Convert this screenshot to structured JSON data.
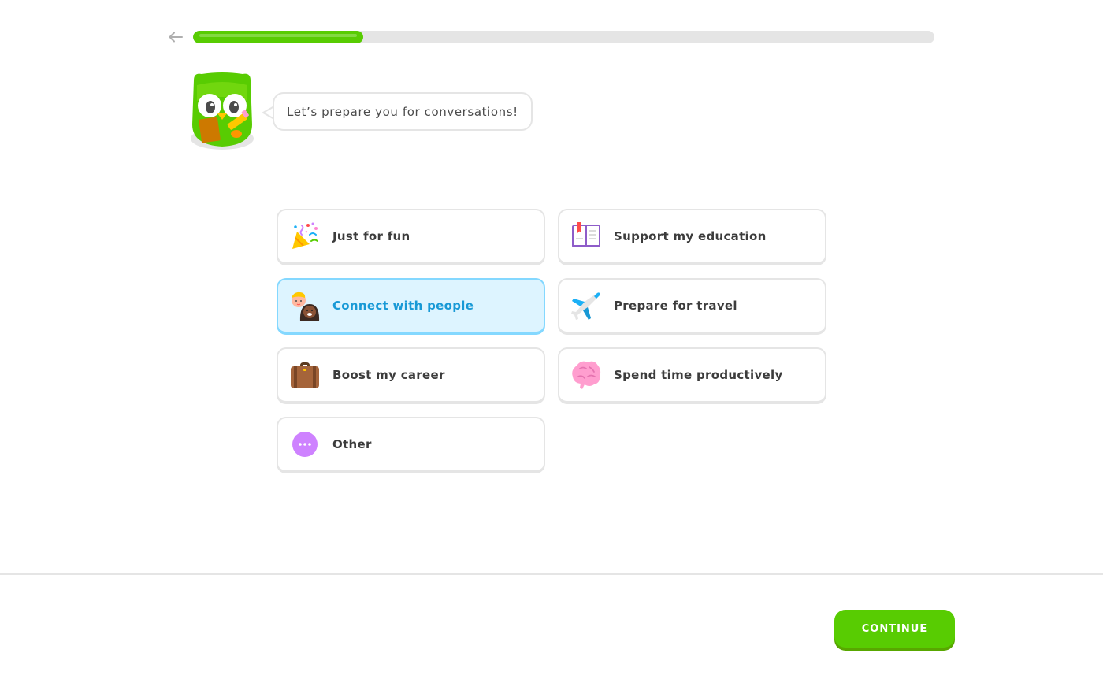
{
  "header": {
    "back_icon": "arrow-left-icon",
    "progress_fraction": 0.23
  },
  "mascot": {
    "icon": "owl-mascot-with-clipboard"
  },
  "speech_bubble": {
    "text": "Let’s prepare you for conversations!"
  },
  "options": [
    {
      "label": "Just for fun",
      "icon": "party-popper-icon",
      "selected": false
    },
    {
      "label": "Support my education",
      "icon": "book-icon",
      "selected": false
    },
    {
      "label": "Connect with people",
      "icon": "people-icon",
      "selected": true
    },
    {
      "label": "Prepare for travel",
      "icon": "airplane-icon",
      "selected": false
    },
    {
      "label": "Boost my career",
      "icon": "briefcase-icon",
      "selected": false
    },
    {
      "label": "Spend time productively",
      "icon": "brain-icon",
      "selected": false
    },
    {
      "label": "Other",
      "icon": "more-dots-icon",
      "selected": false
    }
  ],
  "footer": {
    "continue_label": "CONTINUE"
  },
  "colors": {
    "primary_green": "#58cc02",
    "selected_blue_bg": "#ddf4ff",
    "selected_blue_border": "#84d8ff",
    "selected_blue_text": "#1899d6",
    "border_gray": "#e5e5e5"
  }
}
